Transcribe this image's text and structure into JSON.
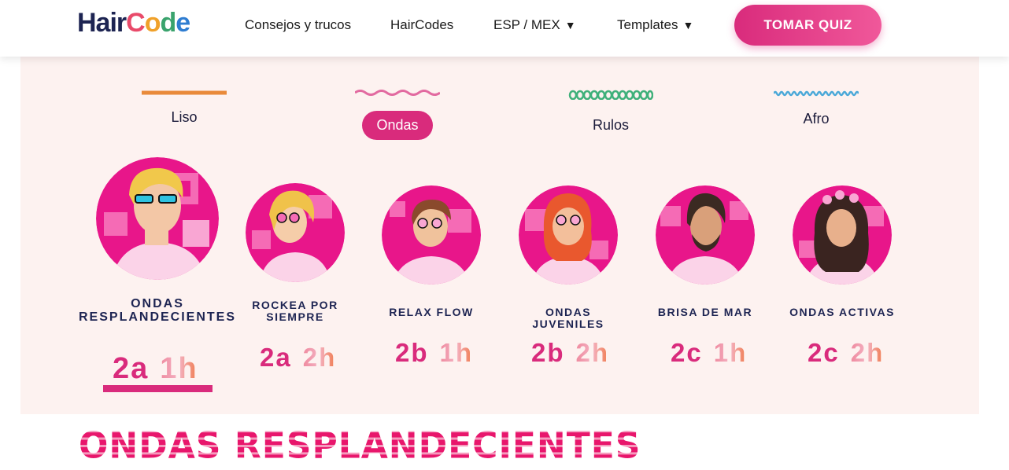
{
  "header": {
    "logo": {
      "hair": "Hair",
      "code_letters": [
        "C",
        "o",
        "d",
        "e"
      ]
    },
    "nav": [
      {
        "label": "Consejos y trucos",
        "has_caret": false
      },
      {
        "label": "HairCodes",
        "has_caret": false
      },
      {
        "label": "ESP / MEX",
        "has_caret": true
      },
      {
        "label": "Templates",
        "has_caret": true
      }
    ],
    "caret": "▼",
    "quiz_button": "TOMAR QUIZ"
  },
  "hair_types": [
    {
      "label": "Liso",
      "selected": false,
      "line": "straight",
      "color": "#e98a3a"
    },
    {
      "label": "Ondas",
      "selected": true,
      "line": "wave",
      "color": "#e26aa0"
    },
    {
      "label": "Rulos",
      "selected": false,
      "line": "coil",
      "color": "#3fb07a"
    },
    {
      "label": "Afro",
      "selected": false,
      "line": "zigzag",
      "color": "#4aa8d8"
    }
  ],
  "profiles": [
    {
      "name": "ONDAS RESPLANDECIENTES",
      "code_a": "2a",
      "code_b": "1h",
      "selected": true,
      "hair_color": "#f1c84b",
      "skin": "#f3c7a6"
    },
    {
      "name": "ROCKEA POR SIEMPRE",
      "code_a": "2a",
      "code_b": "2h",
      "selected": false,
      "hair_color": "#f0c24a",
      "skin": "#f5cda9"
    },
    {
      "name": "RELAX FLOW",
      "code_a": "2b",
      "code_b": "1h",
      "selected": false,
      "hair_color": "#8a4a2c",
      "skin": "#f0c29c"
    },
    {
      "name": "ONDAS JUVENILES",
      "code_a": "2b",
      "code_b": "2h",
      "selected": false,
      "hair_color": "#e9582e",
      "skin": "#f3bf9b"
    },
    {
      "name": "BRISA DE MAR",
      "code_a": "2c",
      "code_b": "1h",
      "selected": false,
      "hair_color": "#3b2a22",
      "skin": "#d9a07a"
    },
    {
      "name": "ONDAS ACTIVAS",
      "code_a": "2c",
      "code_b": "2h",
      "selected": false,
      "hair_color": "#3a2420",
      "skin": "#e8b08c"
    }
  ],
  "section_title": "ONDAS RESPLANDECIENTES",
  "colors": {
    "accent": "#d92b7c",
    "panel_bg": "#fdf2f0",
    "navy": "#1d2452"
  }
}
